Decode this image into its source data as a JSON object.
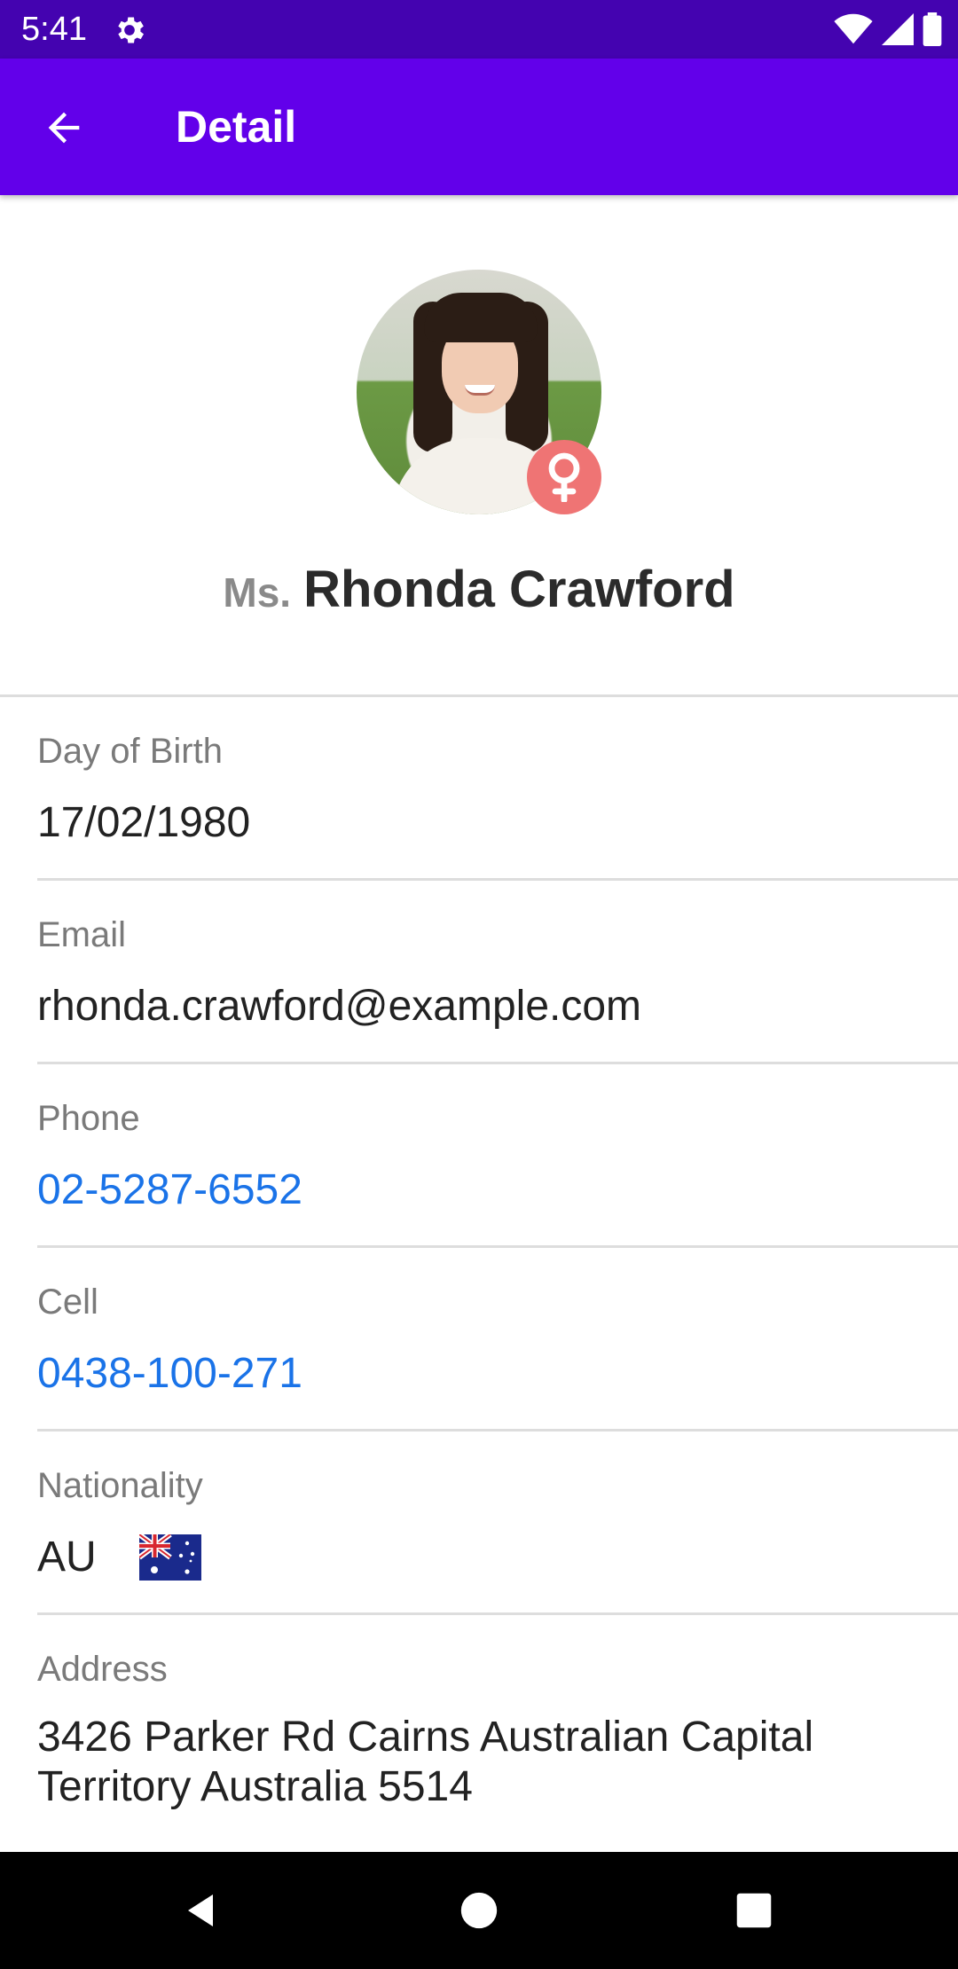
{
  "status_bar": {
    "time": "5:41",
    "icons": [
      "settings-icon",
      "wifi-icon",
      "signal-icon",
      "battery-icon"
    ]
  },
  "app_bar": {
    "title": "Detail",
    "back_icon": "arrow-back-icon",
    "color": "#6200ea"
  },
  "profile": {
    "title": "Ms.",
    "full_name": "Rhonda Crawford",
    "gender_icon": "female-icon",
    "gender_badge_color": "#ef7474"
  },
  "fields": {
    "dob": {
      "label": "Day of Birth",
      "value": "17/02/1980"
    },
    "email": {
      "label": "Email",
      "value": "rhonda.crawford@example.com"
    },
    "phone": {
      "label": "Phone",
      "value": "02-5287-6552"
    },
    "cell": {
      "label": "Cell",
      "value": "0438-100-271"
    },
    "nationality": {
      "label": "Nationality",
      "value": "AU",
      "flag_icon": "australia-flag-icon"
    },
    "address": {
      "label": "Address",
      "value": "3426 Parker Rd Cairns Australian Capital Territory Australia 5514"
    }
  },
  "nav_bar": {
    "icons": [
      "back-triangle-icon",
      "home-circle-icon",
      "recents-square-icon"
    ]
  },
  "colors": {
    "link": "#1a73e8",
    "status_bar": "#4403b0"
  }
}
